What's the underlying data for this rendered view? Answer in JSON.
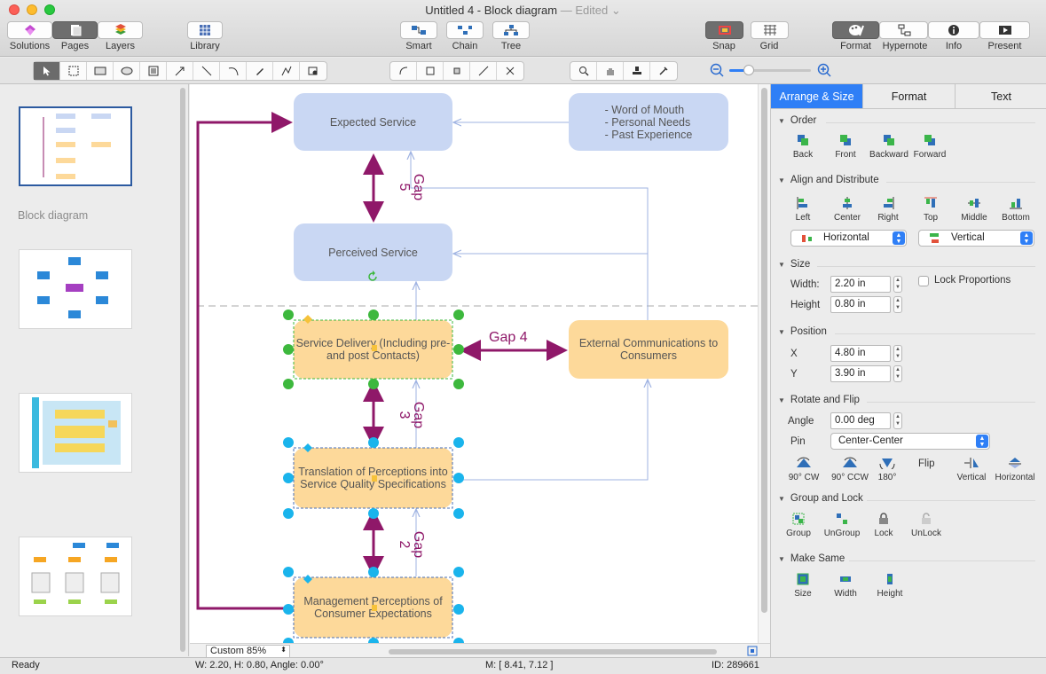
{
  "window": {
    "title": "Untitled 4 - Block diagram",
    "edited": "— Edited ⌄"
  },
  "colors": {
    "accent": "#2f7ff6",
    "magenta": "#8f1869",
    "node_blue": "#c9d7f3",
    "node_orange": "#fdd99a",
    "selection_green": "#3db83d",
    "selection_cyan": "#1ab4ec"
  },
  "toolbar": {
    "solutions": "Solutions",
    "pages": "Pages",
    "layers": "Layers",
    "library": "Library",
    "smart": "Smart",
    "chain": "Chain",
    "tree": "Tree",
    "snap": "Snap",
    "grid": "Grid",
    "format": "Format",
    "hypernote": "Hypernote",
    "info": "Info",
    "present": "Present"
  },
  "tools": {
    "group1": [
      "pointer-icon",
      "text-select-icon",
      "rectangle-icon",
      "ellipse-icon",
      "text-block-icon",
      "arrow-line-icon",
      "line-icon",
      "arc-icon",
      "pen-icon",
      "bezier-icon",
      "insert-shape-icon"
    ],
    "group2": [
      "connector-curve-icon",
      "connector-rect-icon",
      "connector-box-icon",
      "connector-angle-icon",
      "connector-cross-icon"
    ],
    "group3": [
      "zoom-icon",
      "hand-icon",
      "stamp-icon",
      "eyedropper-icon"
    ]
  },
  "pages_panel": {
    "label": "Block diagram"
  },
  "diagram": {
    "expected": "Expected Service",
    "perceived": "Perceived Service",
    "word": "- Word of Mouth\n- Personal Needs\n- Past Experience",
    "delivery": "Service Delivery (Including pre- and post Contacts)",
    "external": "External Communications to Consumers",
    "translation": "Translation of Perceptions into Service Quality Specifications",
    "management": "Management Perceptions of Consumer Expectations",
    "gap5": "Gap\n5",
    "gap4": "Gap 4",
    "gap3": "Gap\n3",
    "gap2": "Gap\n2"
  },
  "canvas_bar": {
    "zoom": "Custom 85%"
  },
  "status": {
    "ready": "Ready",
    "dims": "W: 2.20,  H: 0.80,  Angle: 0.00°",
    "mouse": "M: [ 8.41, 7.12 ]",
    "id": "ID: 289661"
  },
  "inspector": {
    "tabs": [
      "Arrange & Size",
      "Format",
      "Text"
    ],
    "order": {
      "title": "Order",
      "items": [
        "Back",
        "Front",
        "Backward",
        "Forward"
      ]
    },
    "align": {
      "title": "Align and Distribute",
      "items": [
        "Left",
        "Center",
        "Right",
        "Top",
        "Middle",
        "Bottom"
      ],
      "horizontal": "Horizontal",
      "vertical": "Vertical"
    },
    "size": {
      "title": "Size",
      "width_label": "Width:",
      "width": "2.20 in",
      "height_label": "Height",
      "height": "0.80 in",
      "lock": "Lock Proportions"
    },
    "position": {
      "title": "Position",
      "x_label": "X",
      "x": "4.80 in",
      "y_label": "Y",
      "y": "3.90 in"
    },
    "rotate": {
      "title": "Rotate and Flip",
      "angle_label": "Angle",
      "angle": "0.00 deg",
      "pin_label": "Pin",
      "pin": "Center-Center",
      "cw": "90° CW",
      "ccw": "90° CCW",
      "r180": "180°",
      "flip": "Flip",
      "fv": "Vertical",
      "fh": "Horizontal"
    },
    "group": {
      "title": "Group and Lock",
      "items": [
        "Group",
        "UnGroup",
        "Lock",
        "UnLock"
      ]
    },
    "same": {
      "title": "Make Same",
      "items": [
        "Size",
        "Width",
        "Height"
      ]
    }
  }
}
